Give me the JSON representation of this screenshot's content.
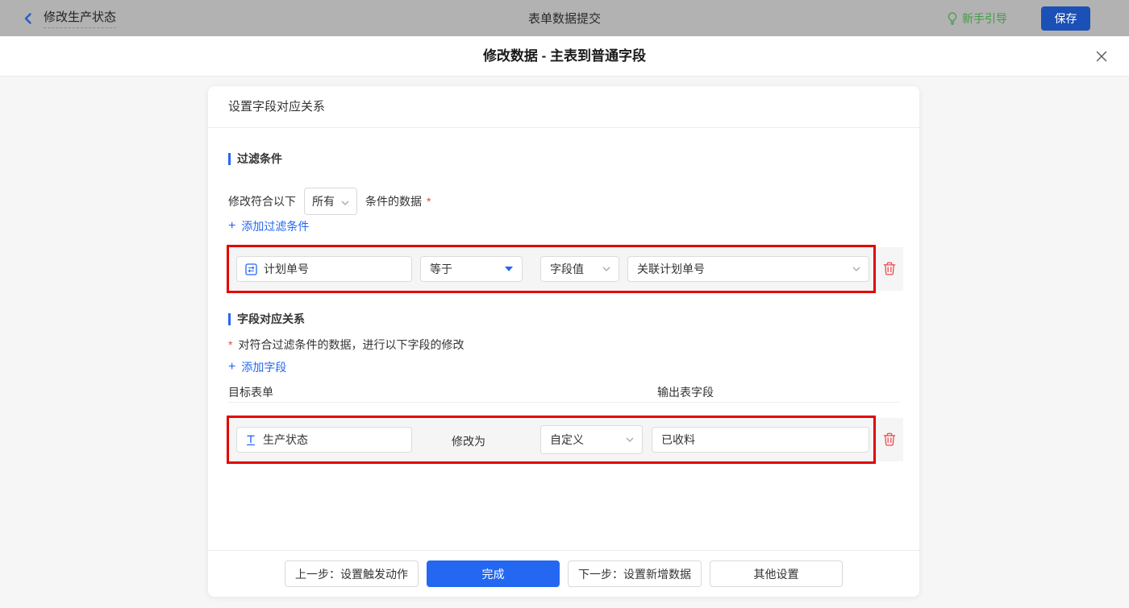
{
  "topbar": {
    "back_label": "修改生产状态",
    "center_title": "表单数据提交",
    "guide_label": "新手引导",
    "save_label": "保存"
  },
  "dialog": {
    "title": "修改数据 - 主表到普通字段"
  },
  "card": {
    "header": "设置字段对应关系",
    "filter": {
      "title": "过滤条件",
      "prefix": "修改符合以下",
      "mode": "所有",
      "suffix": "条件的数据",
      "required": "*",
      "add_plus": "+",
      "add_label": "添加过滤条件",
      "row": {
        "field": "计划单号",
        "operator": "等于",
        "value_type": "字段值",
        "value_field": "关联计划单号"
      }
    },
    "mapping": {
      "title": "字段对应关系",
      "required": "*",
      "description": "对符合过滤条件的数据，进行以下字段的修改",
      "add_plus": "+",
      "add_label": "添加字段",
      "col_target": "目标表单",
      "col_output": "输出表字段",
      "row": {
        "field": "生产状态",
        "action_label": "修改为",
        "value_type": "自定义",
        "value": "已收料"
      }
    },
    "footer": {
      "prev_label": "上一步：设置触发动作",
      "done_label": "完成",
      "next_label": "下一步：设置新增数据",
      "other_label": "其他设置"
    }
  },
  "colors": {
    "accent_blue": "#2468f2",
    "annotation_red": "#e60000",
    "danger_red": "#f0484d",
    "guide_green": "#3f9d44"
  }
}
